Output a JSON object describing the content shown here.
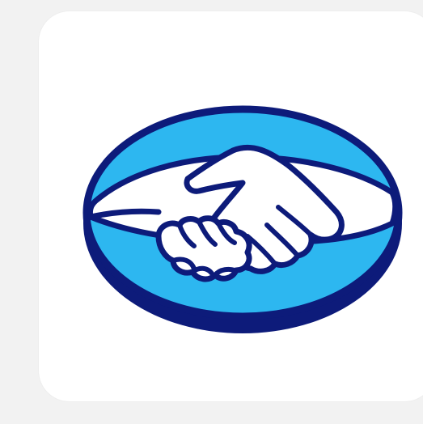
{
  "app_icon": {
    "name": "Mercado Libre",
    "logo_icon": "handshake-icon"
  },
  "colors": {
    "background": "#f2f2f2",
    "card": "#ffffff",
    "ellipse_fill": "#2db7f0",
    "outline": "#0d1b7a",
    "band": "#ffffff"
  }
}
